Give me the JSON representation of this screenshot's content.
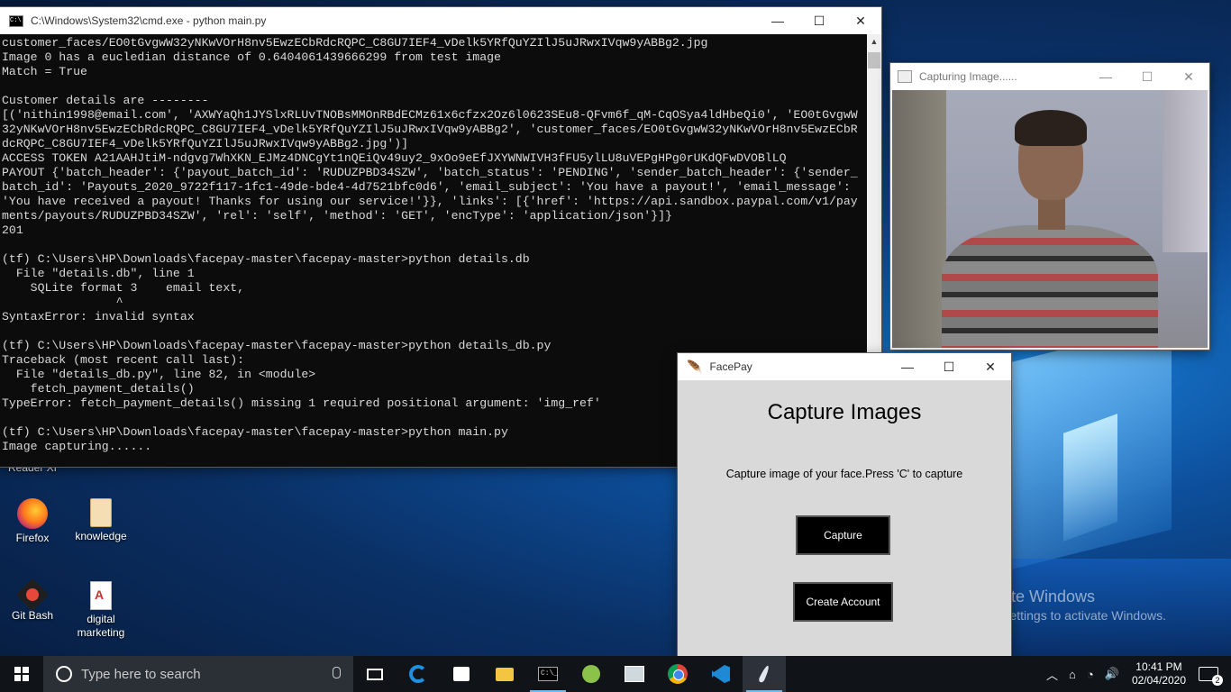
{
  "desktop": {
    "icons": [
      {
        "label": "Firefox",
        "icon": "firefox-icon"
      },
      {
        "label": "knowledge",
        "icon": "folder-icon"
      },
      {
        "label": "Git Bash",
        "icon": "git-bash-icon"
      },
      {
        "label": "digital\nmarketing",
        "icon": "pdf-icon"
      }
    ],
    "partial_label": "Reader XI",
    "watermark": {
      "line1": "Activate Windows",
      "line2": "Go to Settings to activate Windows."
    }
  },
  "cmd_window": {
    "title": "C:\\Windows\\System32\\cmd.exe - python  main.py",
    "console_text": "customer_faces/EO0tGvgwW32yNKwVOrH8nv5EwzECbRdcRQPC_C8GU7IEF4_vDelk5YRfQuYZIlJ5uJRwxIVqw9yABBg2.jpg\nImage 0 has a eucledian distance of 0.6404061439666299 from test image\nMatch = True\n\nCustomer details are --------\n[('nithin1998@email.com', 'AXWYaQh1JYSlxRLUvTNOBsMMOnRBdECMz61x6cfzx2Oz6l0623SEu8-QFvm6f_qM-CqOSya4ldHbeQi0', 'EO0tGvgwW\n32yNKwVOrH8nv5EwzECbRdcRQPC_C8GU7IEF4_vDelk5YRfQuYZIlJ5uJRwxIVqw9yABBg2', 'customer_faces/EO0tGvgwW32yNKwVOrH8nv5EwzECbR\ndcRQPC_C8GU7IEF4_vDelk5YRfQuYZIlJ5uJRwxIVqw9yABBg2.jpg')]\nACCESS TOKEN A21AAHJtiM-ndgvg7WhXKN_EJMz4DNCgYt1nQEiQv49uy2_9xOo9eEfJXYWNWIVH3fFU5ylLU8uVEPgHPg0rUKdQFwDVOBlLQ\nPAYOUT {'batch_header': {'payout_batch_id': 'RUDUZPBD34SZW', 'batch_status': 'PENDING', 'sender_batch_header': {'sender_\nbatch_id': 'Payouts_2020_9722f117-1fc1-49de-bde4-4d7521bfc0d6', 'email_subject': 'You have a payout!', 'email_message':\n'You have received a payout! Thanks for using our service!'}}, 'links': [{'href': 'https://api.sandbox.paypal.com/v1/pay\nments/payouts/RUDUZPBD34SZW', 'rel': 'self', 'method': 'GET', 'encType': 'application/json'}]}\n201\n\n(tf) C:\\Users\\HP\\Downloads\\facepay-master\\facepay-master>python details.db\n  File \"details.db\", line 1\n    SQLite format 3    email text,\n                ^\nSyntaxError: invalid syntax\n\n(tf) C:\\Users\\HP\\Downloads\\facepay-master\\facepay-master>python details_db.py\nTraceback (most recent call last):\n  File \"details_db.py\", line 82, in <module>\n    fetch_payment_details()\nTypeError: fetch_payment_details() missing 1 required positional argument: 'img_ref'\n\n(tf) C:\\Users\\HP\\Downloads\\facepay-master\\facepay-master>python main.py\nImage capturing......"
  },
  "capture_window": {
    "title": "Capturing Image......"
  },
  "facepay_window": {
    "title": "FacePay",
    "heading": "Capture Images",
    "instruction": "Capture image of your face.Press 'C' to capture",
    "capture_button": "Capture",
    "create_account_button": "Create Account"
  },
  "window_controls": {
    "minimize": "—",
    "maximize": "☐",
    "close": "✕"
  },
  "taskbar": {
    "search_placeholder": "Type here to search",
    "pinned": [
      "task-view-icon",
      "edge-icon",
      "store-icon",
      "file-explorer-icon",
      "cmd-icon",
      "android-studio-icon",
      "photos-icon",
      "chrome-icon",
      "vscode-icon",
      "python-feather-icon"
    ],
    "time": "10:41 PM",
    "date": "02/04/2020",
    "notification_count": "2"
  }
}
